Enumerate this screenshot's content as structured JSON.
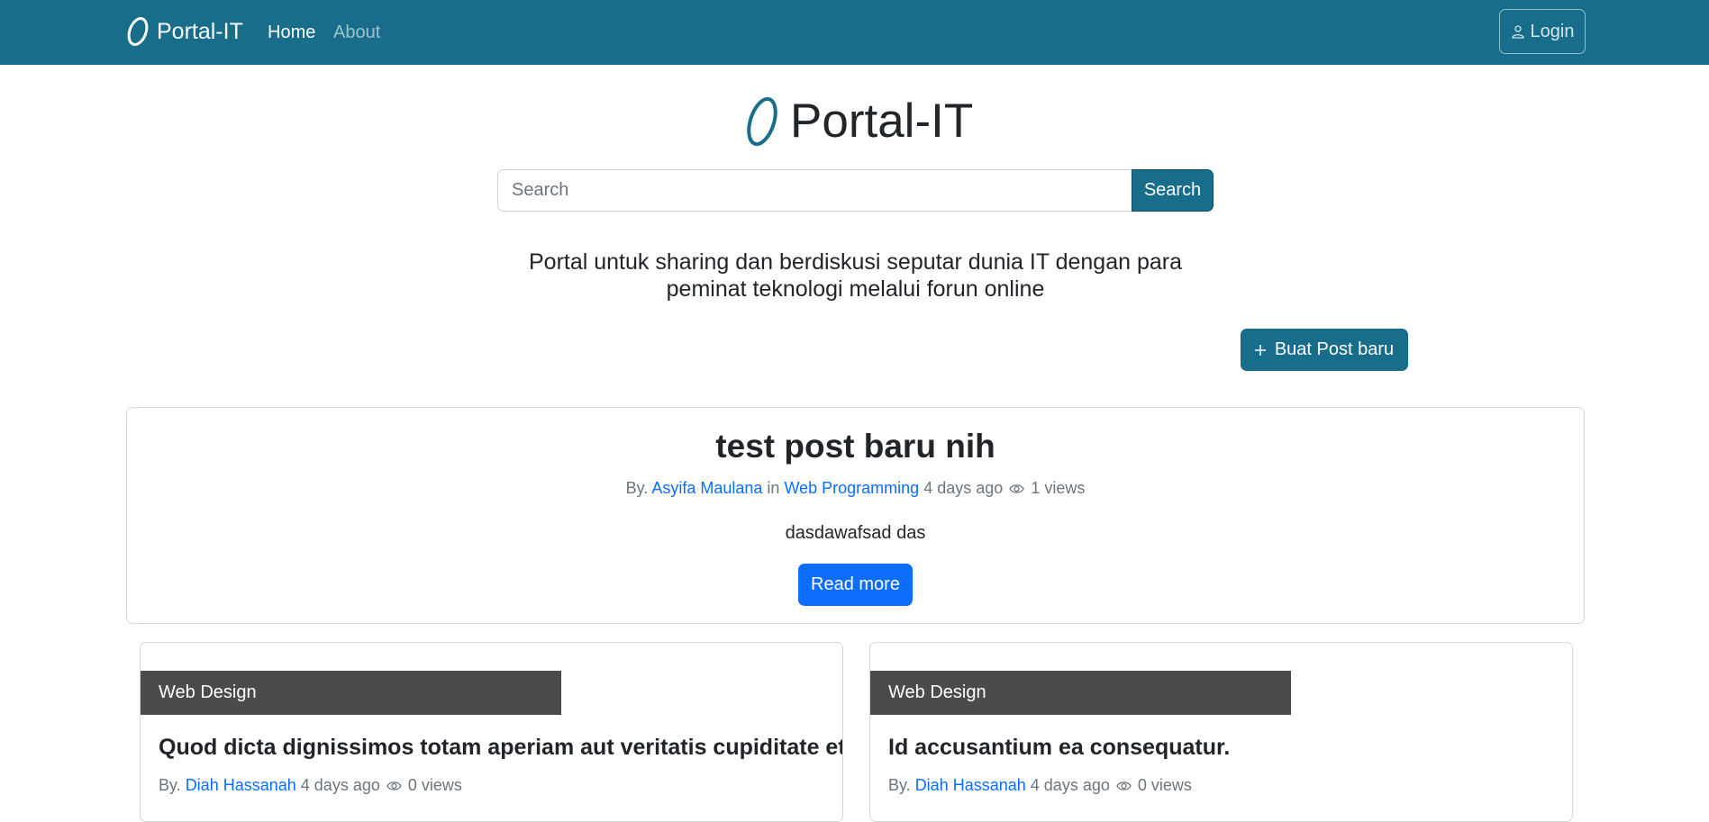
{
  "nav": {
    "brand": "Portal-IT",
    "links": [
      "Home",
      "About"
    ],
    "login": "Login"
  },
  "hero": {
    "title": "Portal-IT",
    "search_placeholder": "Search",
    "search_button": "Search",
    "tagline": "Portal untuk sharing dan berdiskusi seputar dunia IT dengan para peminat teknologi melalui forun online",
    "new_post_button": "Buat Post baru"
  },
  "featured": {
    "title": "test post baru nih",
    "by": "By.",
    "author": "Asyifa Maulana",
    "in": "in",
    "category": "Web Programming",
    "time": "4 days ago",
    "views": "1 views",
    "excerpt": "dasdawafsad das",
    "read_more": "Read more"
  },
  "posts": [
    {
      "category": "Web Design",
      "title": "Quod dicta dignissimos totam aperiam aut veritatis cupiditate et.",
      "by": "By.",
      "author": "Diah Hassanah",
      "time": "4 days ago",
      "views": "0 views"
    },
    {
      "category": "Web Design",
      "title": "Id accusantium ea consequatur.",
      "by": "By.",
      "author": "Diah Hassanah",
      "time": "4 days ago",
      "views": "0 views"
    }
  ],
  "colors": {
    "primary": "#186d8a",
    "link": "#0d6efd",
    "badge": "#4b4b4b"
  }
}
